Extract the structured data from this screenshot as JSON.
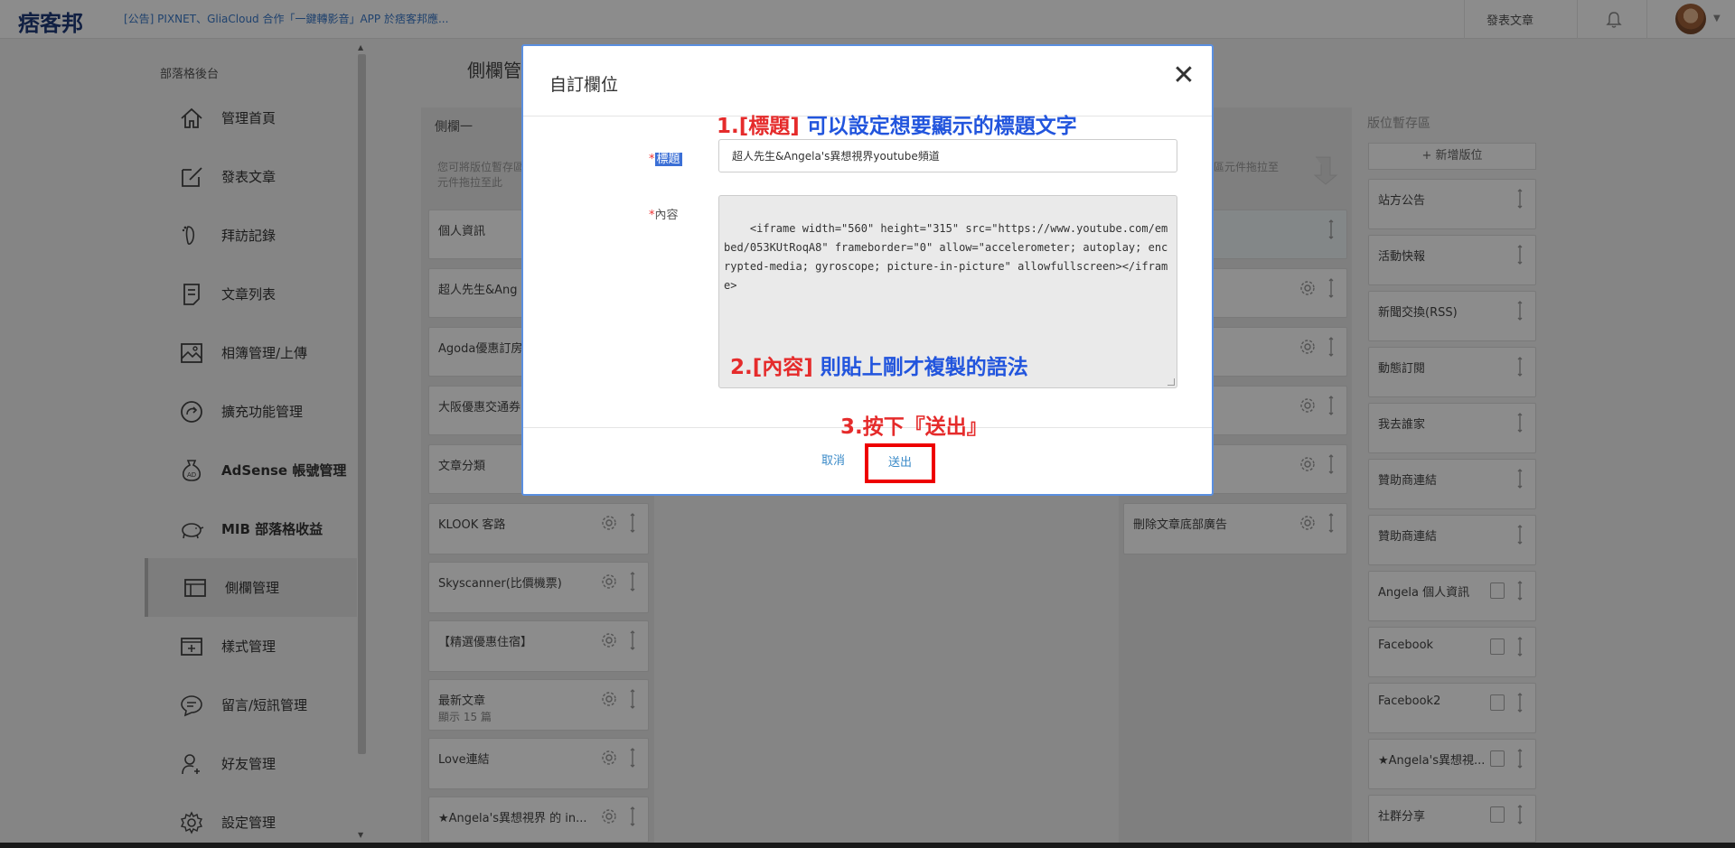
{
  "topbar": {
    "logo": "痞客邦",
    "announcement": "[公告] PIXNET、GliaCloud 合作「一鍵轉影音」APP 於痞客邦應...",
    "post_article": "發表文章"
  },
  "sidebar": {
    "section_label": "部落格後台",
    "items": [
      {
        "label": "管理首頁"
      },
      {
        "label": "發表文章"
      },
      {
        "label": "拜訪記錄"
      },
      {
        "label": "文章列表"
      },
      {
        "label": "相簿管理/上傳"
      },
      {
        "label": "擴充功能管理"
      },
      {
        "label": "AdSense 帳號管理"
      },
      {
        "label": "MIB 部落格收益"
      },
      {
        "label": "側欄管理"
      },
      {
        "label": "樣式管理"
      },
      {
        "label": "留言/短訊管理"
      },
      {
        "label": "好友管理"
      },
      {
        "label": "設定管理"
      }
    ]
  },
  "main": {
    "page_title": "側欄管",
    "col1": {
      "header": "側欄一",
      "hint": "您可將版位暫存區的元件拖拉至此",
      "cards": [
        {
          "title": "個人資訊",
          "sub": ""
        },
        {
          "title": "超人先生&Ang",
          "sub": ""
        },
        {
          "title": "Agoda優惠訂房",
          "sub": ""
        },
        {
          "title": "大阪優惠交通券",
          "sub": ""
        },
        {
          "title": "文章分類",
          "sub": ""
        },
        {
          "title": "KLOOK 客路",
          "sub": ""
        },
        {
          "title": "Skyscanner(比價機票)",
          "sub": ""
        },
        {
          "title": "【精選優惠住宿】",
          "sub": ""
        },
        {
          "title": "最新文章",
          "sub": "顯示 15 篇"
        },
        {
          "title": "Love連結",
          "sub": ""
        },
        {
          "title": "★Angela's異想視界 的 in...",
          "sub": ""
        }
      ]
    },
    "col3": {
      "hint": "區元件拖拉至",
      "cards": [
        {
          "title": ""
        },
        {
          "title": ""
        },
        {
          "title": ""
        },
        {
          "title": ""
        },
        {
          "title": ""
        },
        {
          "title": "刪除文章底部廣告"
        }
      ]
    },
    "col4": {
      "header": "版位暫存區",
      "add_slot": "+ 新增版位",
      "cards": [
        {
          "title": "站方公告"
        },
        {
          "title": "活動快報"
        },
        {
          "title": "新聞交換(RSS)"
        },
        {
          "title": "動態訂閱"
        },
        {
          "title": "我去誰家"
        },
        {
          "title": "贊助商連結"
        },
        {
          "title": "贊助商連結"
        },
        {
          "title": "Angela 個人資訊"
        },
        {
          "title": "Facebook"
        },
        {
          "title": "Facebook2"
        },
        {
          "title": "★Angela's異想視..."
        },
        {
          "title": "社群分享"
        }
      ]
    }
  },
  "modal": {
    "title": "自訂欄位",
    "title_field_label": "標題",
    "title_field_value": "超人先生&Angela's異想視界youtube頻道",
    "content_field_label": "內容",
    "content_value": "<iframe width=\"560\" height=\"315\" src=\"https://www.youtube.com/embed/053KUtRoqA8\" frameborder=\"0\" allow=\"accelerometer; autoplay; encrypted-media; gyroscope; picture-in-picture\" allowfullscreen></iframe>",
    "cancel_label": "取消",
    "submit_label": "送出",
    "close_glyph": "✕"
  },
  "annotations": {
    "a1_num": "1.",
    "a1_red": "[標題]",
    "a1_blue": " 可以設定想要顯示的標題文字",
    "a2_num": "2.",
    "a2_red": "[內容]",
    "a2_blue": " 則貼上剛才複製的語法",
    "a3_text": "3.按下『",
    "a3_red": "送出",
    "a3_end": "』"
  },
  "colors": {
    "highlight_red": "#e00000",
    "annotation_blue": "#2255dd",
    "link_blue": "#3a8ac8",
    "modal_border": "#5a8fe0"
  }
}
